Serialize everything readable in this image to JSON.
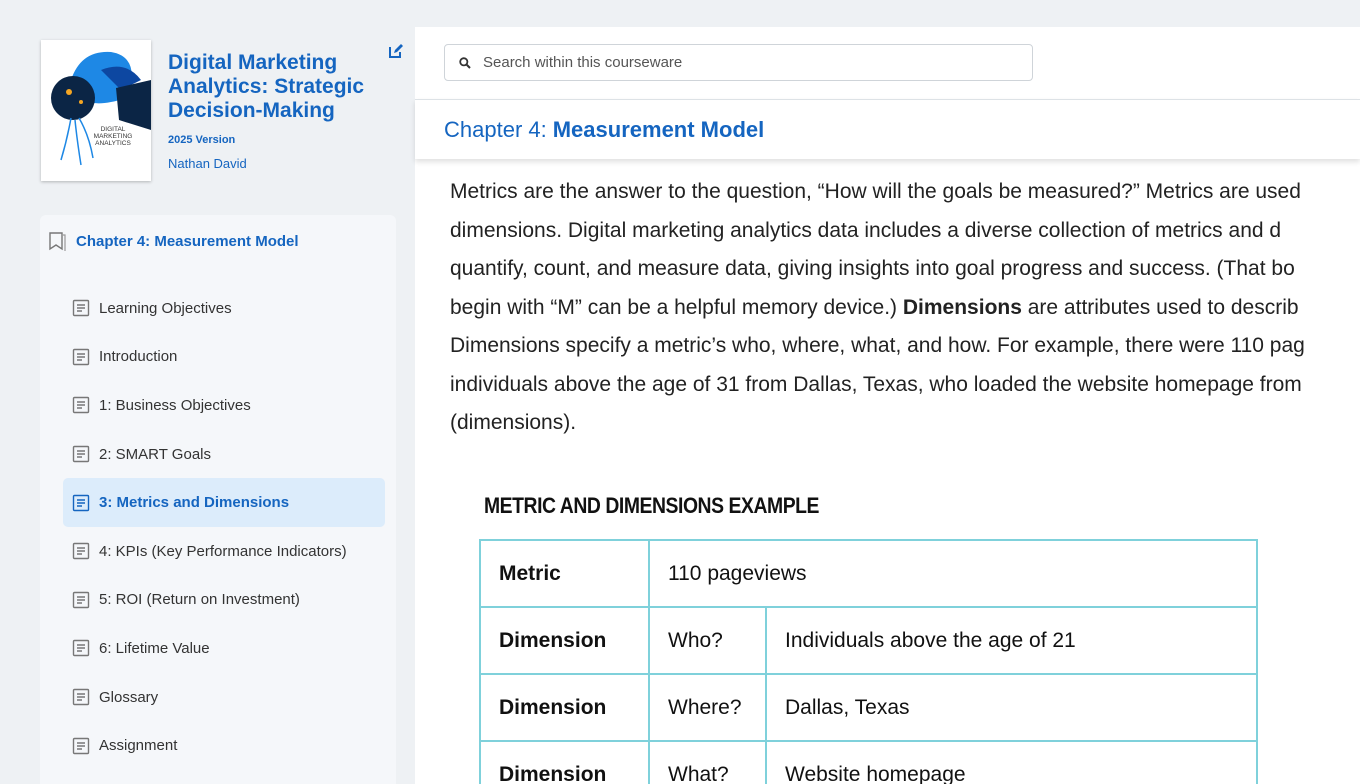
{
  "book": {
    "title": "Digital Marketing Analytics: Strategic Decision-Making",
    "version": "2025 Version",
    "author": "Nathan David",
    "cover_text": [
      "DIGITAL",
      "MARKETING",
      "ANALYTICS"
    ]
  },
  "toc": {
    "chapter_label": "Chapter 4: Measurement Model",
    "items": [
      {
        "label": "Learning Objectives"
      },
      {
        "label": "Introduction"
      },
      {
        "label": "1: Business Objectives"
      },
      {
        "label": "2: SMART Goals"
      },
      {
        "label": "3: Metrics and Dimensions",
        "active": true
      },
      {
        "label": "4: KPIs (Key Performance Indicators)"
      },
      {
        "label": "5: ROI (Return on Investment)"
      },
      {
        "label": "6: Lifetime Value"
      },
      {
        "label": "Glossary"
      },
      {
        "label": "Assignment"
      }
    ]
  },
  "search": {
    "placeholder": "Search within this courseware"
  },
  "chapter_header": {
    "prefix": "Chapter 4:",
    "title": "Measurement Model"
  },
  "content": {
    "lines": [
      "Metrics are the answer to the question, “How will the goals be measured?” Metrics are used",
      "dimensions. Digital marketing analytics data includes a diverse collection of metrics and d",
      "quantify, count, and measure data, giving insights into goal progress and success. (That bo",
      [
        "begin with “M” can be a helpful memory device.) ",
        "Dimensions",
        " are attributes used to describ"
      ],
      "Dimensions specify a metric’s who, where, what, and how. For example, there were 110 pag",
      "individuals above the age of 31 from Dallas, Texas, who loaded the website homepage from",
      "(dimensions)."
    ]
  },
  "table": {
    "title": "METRIC AND DIMENSIONS EXAMPLE",
    "metric_label": "Metric",
    "metric_value": "110 pageviews",
    "rows": [
      {
        "label": "Dimension",
        "question": "Who?",
        "value": "Individuals above the age of 21"
      },
      {
        "label": "Dimension",
        "question": "Where?",
        "value": "Dallas, Texas"
      },
      {
        "label": "Dimension",
        "question": "What?",
        "value": "Website homepage"
      }
    ]
  },
  "colors": {
    "accent": "#1565c0",
    "active_bg": "#dcecfb",
    "table_border": "#7fd1db"
  }
}
